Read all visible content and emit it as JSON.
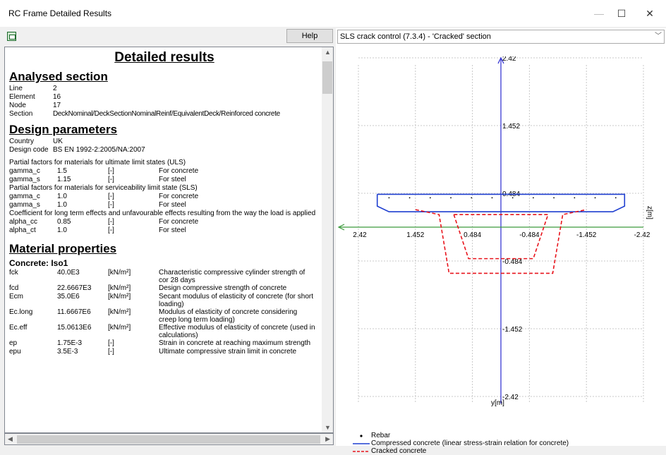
{
  "window": {
    "title": "RC Frame Detailed Results",
    "minimize_label": "—",
    "maximize_label": "☐",
    "close_label": "✕"
  },
  "toolbar": {
    "help_label": "Help"
  },
  "results": {
    "title": "Detailed results",
    "analysed_section": {
      "heading": "Analysed section",
      "rows": [
        {
          "label": "Line",
          "value": "2"
        },
        {
          "label": "Element",
          "value": "16"
        },
        {
          "label": "Node",
          "value": "17"
        },
        {
          "label": "Section",
          "value": "DeckNominal/DeckSectionNominalReinf/EquivalentDeck/Reinforced concrete"
        }
      ]
    },
    "design_parameters": {
      "heading": "Design parameters",
      "rows": [
        {
          "label": "Country",
          "value": "UK"
        },
        {
          "label": "Design code",
          "value": "BS EN 1992-2:2005/NA:2007"
        }
      ],
      "uls_note": "Partial factors for materials for ultimate limit states (ULS)",
      "uls_rows": [
        {
          "label": "gamma_c",
          "value": "1.5",
          "unit": "[-]",
          "desc": "For concrete"
        },
        {
          "label": "gamma_s",
          "value": "1.15",
          "unit": "[-]",
          "desc": "For steel"
        }
      ],
      "sls_note": "Partial factors for materials for serviceability limit state (SLS)",
      "sls_rows": [
        {
          "label": "gamma_c",
          "value": "1.0",
          "unit": "[-]",
          "desc": "For concrete"
        },
        {
          "label": "gamma_s",
          "value": "1.0",
          "unit": "[-]",
          "desc": "For steel"
        }
      ],
      "coef_note": "Coefficient for long term effects and unfavourable effects resulting from the way the load is applied",
      "coef_rows": [
        {
          "label": "alpha_cc",
          "value": "0.85",
          "unit": "[-]",
          "desc": "For concrete"
        },
        {
          "label": "alpha_ct",
          "value": "1.0",
          "unit": "[-]",
          "desc": "For steel"
        }
      ]
    },
    "material_properties": {
      "heading": "Material properties",
      "concrete_heading": "Concrete: Iso1",
      "rows": [
        {
          "label": "fck",
          "value": "40.0E3",
          "unit": "[kN/m²]",
          "desc": "Characteristic compressive cylinder strength of cor 28 days"
        },
        {
          "label": "fcd",
          "value": "22.6667E3",
          "unit": "[kN/m²]",
          "desc": "Design compressive strength of concrete"
        },
        {
          "label": "Ecm",
          "value": "35.0E6",
          "unit": "[kN/m²]",
          "desc": "Secant modulus of elasticity of concrete (for short loading)"
        },
        {
          "label": "Ec.long",
          "value": "11.6667E6",
          "unit": "[kN/m²]",
          "desc": "Modulus of elasticity of concrete considering creep long term loading)"
        },
        {
          "label": "Ec.eff",
          "value": "15.0613E6",
          "unit": "[kN/m²]",
          "desc": "Effective modulus of elasticity of concrete (used in calculations)"
        },
        {
          "label": "ep",
          "value": "1.75E-3",
          "unit": "[-]",
          "desc": "Strain in concrete at reaching maximum strength"
        },
        {
          "label": "epu",
          "value": "3.5E-3",
          "unit": "[-]",
          "desc": "Ultimate compressive strain limit in concrete"
        }
      ]
    }
  },
  "plot_selector": {
    "selected": "SLS crack control (7.3.4) - 'Cracked' section"
  },
  "chart_data": {
    "type": "line",
    "x_axis": {
      "label": "y[m]",
      "ticks": [
        "2.42",
        "1.452",
        "0.484",
        "-0.484",
        "-1.452",
        "-2.42"
      ],
      "range": [
        2.42,
        -2.42
      ]
    },
    "y_axis": {
      "label": "z[m]",
      "ticks": [
        "2.42",
        "1.452",
        "0.484",
        "-0.484",
        "-1.452",
        "-2.42"
      ],
      "range": [
        -2.42,
        2.42
      ]
    },
    "grid": true,
    "legend_position": "bottom-left",
    "series": [
      {
        "name": "Compressed concrete (linear stress-strain relation for concrete)",
        "style": "solid",
        "color": "#1f3fd0",
        "x": [
          2.1,
          -2.1,
          -2.1,
          -1.9,
          1.9,
          2.1,
          2.1
        ],
        "y": [
          0.47,
          0.47,
          0.3,
          0.22,
          0.22,
          0.3,
          0.47
        ]
      },
      {
        "name": "Cracked concrete",
        "style": "dashed",
        "color": "#e8141c",
        "x": [
          1.45,
          1.05,
          0.88,
          -0.88,
          -1.05,
          -1.45
        ],
        "y": [
          0.25,
          0.18,
          -0.66,
          -0.66,
          0.18,
          0.25
        ]
      },
      {
        "name": "Cracked concrete inner",
        "style": "dashed",
        "color": "#e8141c",
        "x": [
          0.8,
          0.55,
          -0.55,
          -0.8,
          0.8
        ],
        "y": [
          0.18,
          -0.45,
          -0.45,
          0.18,
          0.18
        ]
      }
    ],
    "rebar_points": {
      "name": "Rebar",
      "x": [
        1.9,
        1.55,
        1.2,
        0.85,
        0.5,
        0.15,
        -0.2,
        -0.55,
        -0.9,
        -1.25,
        -1.6,
        -1.95
      ],
      "y": [
        0.42,
        0.42,
        0.42,
        0.42,
        0.42,
        0.42,
        0.42,
        0.42,
        0.42,
        0.42,
        0.42,
        0.42
      ]
    },
    "legend": [
      {
        "label": "Rebar",
        "symbol": "dot"
      },
      {
        "label": "Compressed concrete (linear stress-strain relation for concrete)",
        "symbol": "solid"
      },
      {
        "label": "Cracked concrete",
        "symbol": "dashed"
      }
    ],
    "colors": {
      "compressed": "#1f3fd0",
      "cracked": "#e8141c",
      "y_axis": "#2a2ad0",
      "x_axis": "#3c9a3c",
      "grid": "#c8c8c8"
    }
  }
}
